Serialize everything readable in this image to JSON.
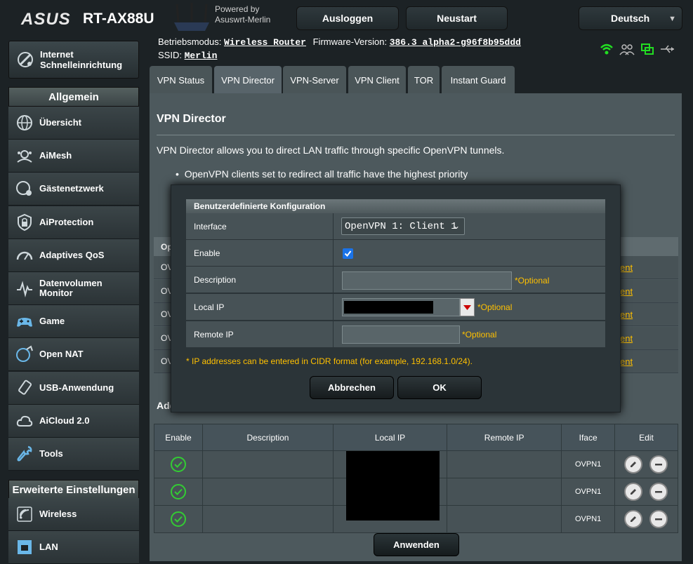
{
  "header": {
    "brand": "ASUS",
    "model": "RT-AX88U",
    "powered_by": "Powered by",
    "powered_name": "Asuswrt-Merlin",
    "logout_label": "Ausloggen",
    "reboot_label": "Neustart",
    "language_label": "Deutsch"
  },
  "info": {
    "mode_label": "Betriebsmodus:",
    "mode_value": "Wireless Router",
    "firmware_label": "Firmware-Version:",
    "firmware_value": "386.3_alpha2-g96f8b95ddd",
    "ssid_label": "SSID:",
    "ssid_value": "Merlin"
  },
  "sidebar": {
    "quick_setup": "Internet Schnelleinrichtung",
    "general_header": "Allgemein",
    "items": [
      {
        "label": "Übersicht",
        "icon": "globe-network-icon"
      },
      {
        "label": "AiMesh",
        "icon": "aimesh-icon"
      },
      {
        "label": "Gästenetzwerk",
        "icon": "guest-network-icon"
      },
      {
        "label": "AiProtection",
        "icon": "lock-shield-icon"
      },
      {
        "label": "Adaptives QoS",
        "icon": "gauge-icon"
      },
      {
        "label": "Datenvolumen Monitor",
        "icon": "traffic-monitor-icon"
      },
      {
        "label": "Game",
        "icon": "gamepad-icon"
      },
      {
        "label": "Open NAT",
        "icon": "open-nat-icon"
      },
      {
        "label": "USB-Anwendung",
        "icon": "usb-icon"
      },
      {
        "label": "AiCloud 2.0",
        "icon": "cloud-icon"
      },
      {
        "label": "Tools",
        "icon": "wrench-icon"
      }
    ],
    "advanced_header": "Erweiterte Einstellungen",
    "advanced_items": [
      {
        "label": "Wireless",
        "icon": "wireless-icon"
      },
      {
        "label": "LAN",
        "icon": "lan-icon"
      }
    ]
  },
  "tabs": [
    "VPN Status",
    "VPN Director",
    "VPN-Server",
    "VPN Client",
    "TOR",
    "Instant Guard"
  ],
  "page": {
    "title": "VPN Director",
    "description": "VPN Director allows you to direct LAN traffic through specific OpenVPN tunnels.",
    "bullet": "OpenVPN clients set to redirect all traffic have the highest priority",
    "bg_header_fragment": "Op",
    "bg_rows": [
      "OV",
      "OV",
      "OV",
      "OV",
      "OV"
    ],
    "bg_link": "ent",
    "add_fragment": "Add"
  },
  "rules_table": {
    "headers": [
      "Enable",
      "Description",
      "Local IP",
      "Remote IP",
      "Iface",
      "Edit"
    ],
    "rows": [
      {
        "iface": "OVPN1"
      },
      {
        "iface": "OVPN1"
      },
      {
        "iface": "OVPN1"
      }
    ],
    "apply_label": "Anwenden"
  },
  "modal": {
    "title": "Benutzerdefinierte Konfiguration",
    "interface_label": "Interface",
    "interface_value": "OpenVPN 1: Client 1",
    "enable_label": "Enable",
    "description_label": "Description",
    "local_ip_label": "Local IP",
    "remote_ip_label": "Remote IP",
    "optional": "*Optional",
    "note": "* IP addresses can be entered in CIDR format (for example, 192.168.1.0/24).",
    "cancel_label": "Abbrechen",
    "ok_label": "OK"
  },
  "colors": {
    "accent_yellow": "#ffc000",
    "enabled_green": "#33cc33",
    "status_green": "#22dd22"
  }
}
